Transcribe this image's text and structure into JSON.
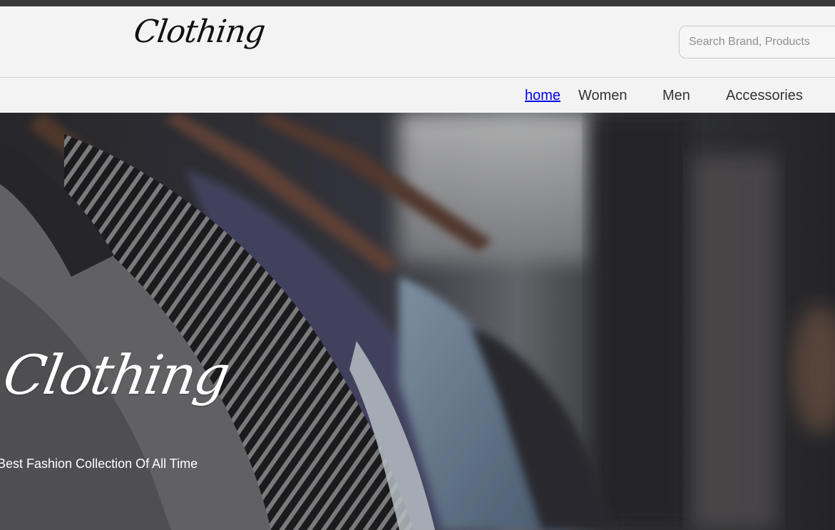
{
  "header": {
    "logo_text": "Clothing",
    "search": {
      "placeholder": "Search Brand, Products",
      "value": ""
    }
  },
  "nav": {
    "items": [
      {
        "label": "home",
        "active_link": true
      },
      {
        "label": "Women"
      },
      {
        "label": "Men"
      },
      {
        "label": "Accessories"
      }
    ]
  },
  "hero": {
    "title": "Clothing",
    "subtitle": "Best Fashion Collection Of All Time"
  },
  "colors": {
    "header_bg": "#f3f3f3",
    "link": "#0000ee",
    "top_bar": "#3a3a3a"
  }
}
